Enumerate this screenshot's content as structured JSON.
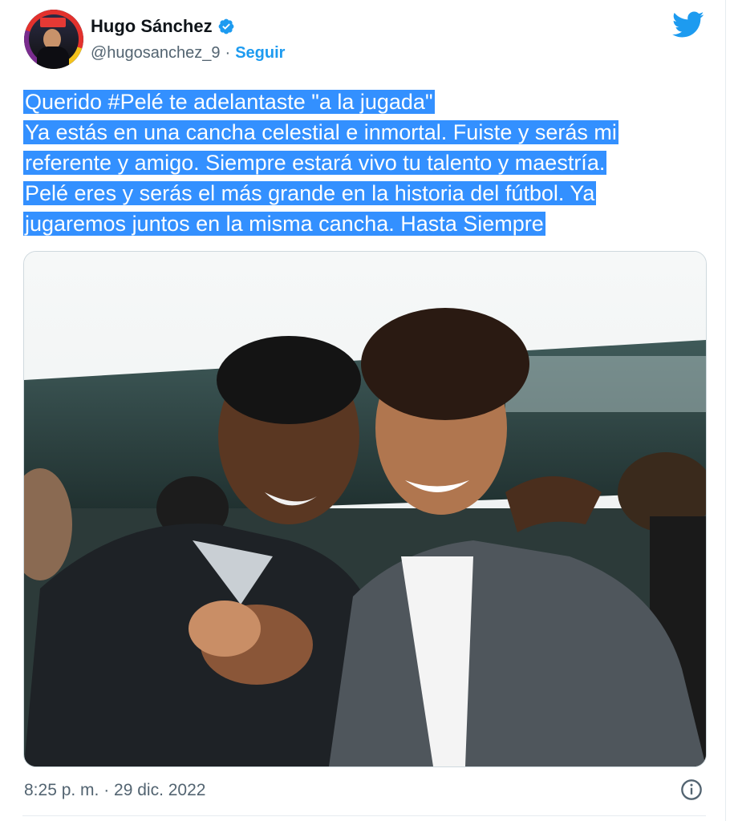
{
  "author": {
    "display_name": "Hugo Sánchez",
    "handle": "@hugosanchez_9",
    "separator": "·",
    "follow_label": "Seguir",
    "avatar_icon": "user-avatar-icon",
    "verified_icon": "verified-badge-icon"
  },
  "tweet": {
    "lines": [
      "Querido #Pelé te adelantaste \"a la jugada\"",
      "Ya estás en una cancha celestial e inmortal. Fuiste y serás mi",
      "referente y amigo. Siempre estará vivo tu talento y maestría.",
      "Pelé eres y serás el más grande en la historia del fútbol. Ya",
      "jugaremos juntos en la misma cancha. Hasta Siempre"
    ],
    "timestamp": "8:25 p. m. · 29 dic. 2022"
  },
  "colors": {
    "accent": "#1d9bf0",
    "selection": "#3390ff",
    "muted": "#536471"
  },
  "icons": {
    "logo": "twitter-bird-icon",
    "info": "info-icon"
  }
}
